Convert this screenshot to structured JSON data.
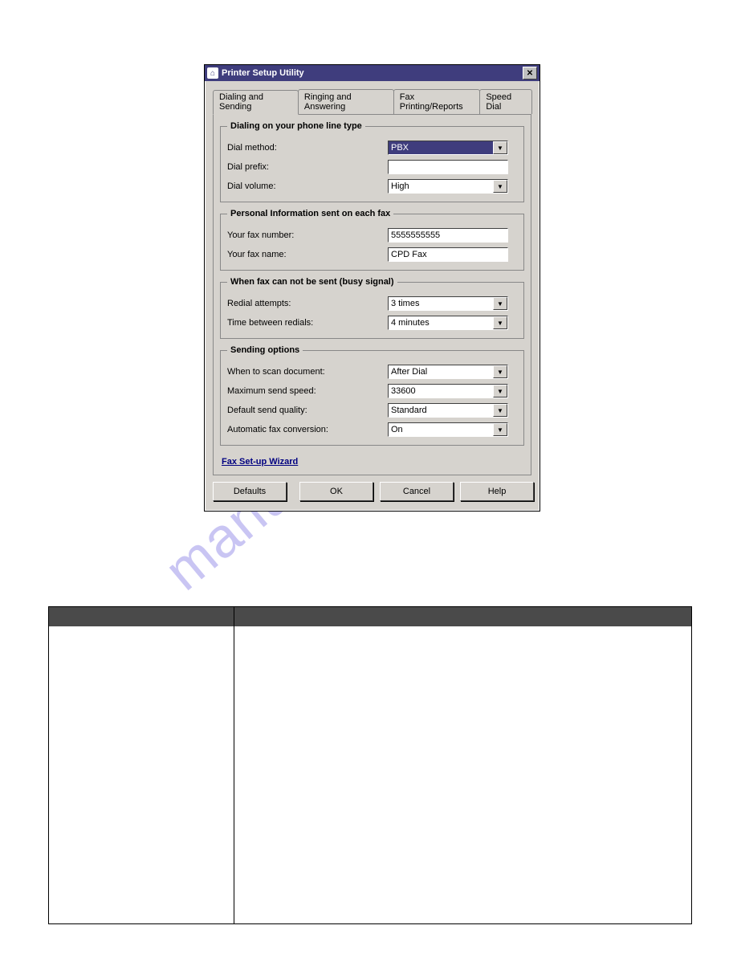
{
  "window": {
    "title": "Printer Setup Utility",
    "close_glyph": "✕",
    "app_icon_glyph": "⌂"
  },
  "tabs": {
    "items": [
      {
        "label": "Dialing and Sending",
        "active": true
      },
      {
        "label": "Ringing and Answering"
      },
      {
        "label": "Fax Printing/Reports"
      },
      {
        "label": "Speed Dial"
      }
    ]
  },
  "groups": {
    "dialing": {
      "legend": "Dialing on your phone line type",
      "dial_method_label": "Dial method:",
      "dial_method_value": "PBX",
      "dial_prefix_label": "Dial prefix:",
      "dial_prefix_value": "",
      "dial_volume_label": "Dial volume:",
      "dial_volume_value": "High"
    },
    "personal": {
      "legend": "Personal Information sent on each fax",
      "fax_number_label": "Your fax number:",
      "fax_number_value": "5555555555",
      "fax_name_label": "Your fax name:",
      "fax_name_value": "CPD Fax"
    },
    "busy": {
      "legend": "When fax can not be sent (busy signal)",
      "redial_attempts_label": "Redial attempts:",
      "redial_attempts_value": "3 times",
      "time_between_label": "Time between redials:",
      "time_between_value": "4 minutes"
    },
    "sending": {
      "legend": "Sending options",
      "when_scan_label": "When to scan document:",
      "when_scan_value": "After Dial",
      "max_speed_label": "Maximum send speed:",
      "max_speed_value": "33600",
      "quality_label": "Default send quality:",
      "quality_value": "Standard",
      "auto_conv_label": "Automatic fax conversion:",
      "auto_conv_value": "On"
    }
  },
  "link": {
    "wizard": "Fax Set-up Wizard"
  },
  "buttons": {
    "defaults": "Defaults",
    "ok": "OK",
    "cancel": "Cancel",
    "help": "Help"
  },
  "dropdown_glyph": "▼",
  "watermark": "manualshive.com"
}
